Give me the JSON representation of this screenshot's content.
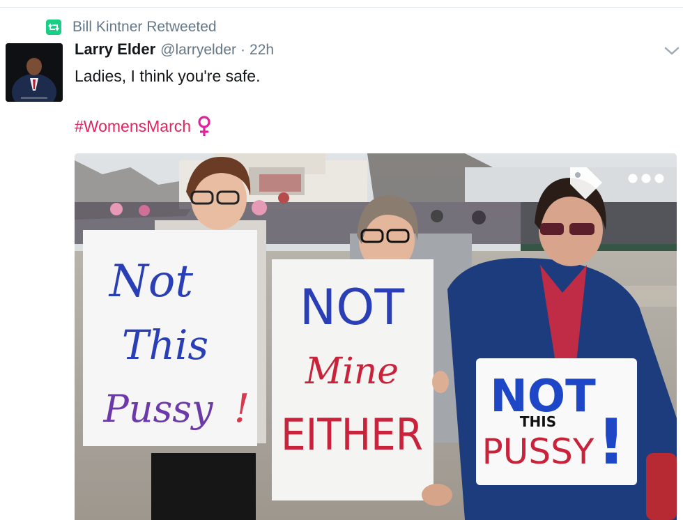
{
  "retweet": {
    "icon": "retweet-icon",
    "text": "Bill Kintner Retweeted"
  },
  "tweet": {
    "author_name": "Larry Elder",
    "author_handle": "@larryelder",
    "separator": "·",
    "time": "22h",
    "text": "Ladies, I think you're safe.",
    "hashtag": "#WomensMarch",
    "emoji": "venus-symbol-icon",
    "menu_icon": "chevron-down-icon"
  },
  "media": {
    "overlay_icons": [
      "tag-icon",
      "more-dots-icon"
    ],
    "signs": {
      "left": [
        "Not",
        "This",
        "Pussy",
        "!"
      ],
      "middle": [
        "NOT",
        "Mine",
        "EITHER"
      ],
      "right": [
        "NOT",
        "THIS",
        "PUSSY",
        "!"
      ]
    }
  },
  "colors": {
    "retweet_green": "#19cf86",
    "hashtag_pink": "#e0245e",
    "secondary_text": "#657786",
    "sign_blue": "#2a3fb5",
    "sign_red": "#c8233a"
  }
}
